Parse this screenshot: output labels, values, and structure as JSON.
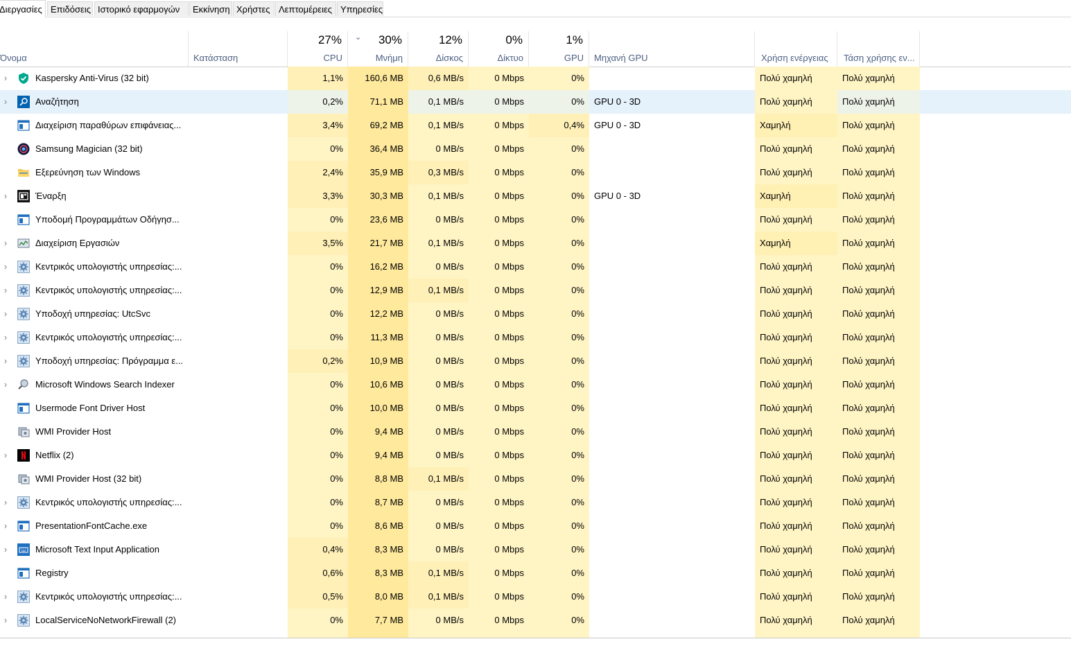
{
  "tabs": [
    "Διεργασίες",
    "Επιδόσεις",
    "Ιστορικό εφαρμογών",
    "Εκκίνηση",
    "Χρήστες",
    "Λεπτομέρειες",
    "Υπηρεσίες"
  ],
  "headers": {
    "name": "Όνομα",
    "status": "Κατάσταση",
    "cpu": {
      "pct": "27%",
      "label": "CPU"
    },
    "memory": {
      "pct": "30%",
      "label": "Μνήμη"
    },
    "disk": {
      "pct": "12%",
      "label": "Δίσκος"
    },
    "network": {
      "pct": "0%",
      "label": "Δίκτυο"
    },
    "gpu": {
      "pct": "1%",
      "label": "GPU"
    },
    "gpu_engine": "Μηχανή GPU",
    "power": "Χρήση ενέργειας",
    "power_trend": "Τάση χρήσης εν..."
  },
  "colors": {
    "heat_light": "#fff4c4",
    "heat_mid": "#ffe99c",
    "heat_power": "#fff0b4",
    "selected": "#e5f1fb"
  },
  "processes": [
    {
      "name": "Kaspersky Anti-Virus (32 bit)",
      "icon": "kaspersky-icon",
      "expandable": true,
      "cpu": "1,1%",
      "mem": "160,6 MB",
      "disk": "0,6 MB/s",
      "net": "0 Mbps",
      "gpu": "0%",
      "engine": "",
      "power": "Πολύ χαμηλή",
      "trend": "Πολύ χαμηλή",
      "heat": {
        "cpu": 1,
        "mem": 2,
        "disk": 1,
        "net": 0,
        "gpu": 0,
        "power": 0
      }
    },
    {
      "name": "Αναζήτηση",
      "icon": "search-icon",
      "expandable": true,
      "selected": true,
      "cpu": "0,2%",
      "mem": "71,1 MB",
      "disk": "0,1 MB/s",
      "net": "0 Mbps",
      "gpu": "0%",
      "engine": "GPU 0 - 3D",
      "power": "Πολύ χαμηλή",
      "trend": "Πολύ χαμηλή",
      "heat": {
        "cpu": 0,
        "mem": 1,
        "disk": 0,
        "net": 0,
        "gpu": 0,
        "power": 0
      }
    },
    {
      "name": "Διαχείριση παραθύρων επιφάνειας...",
      "icon": "window-icon",
      "expandable": false,
      "cpu": "3,4%",
      "mem": "69,2 MB",
      "disk": "0,1 MB/s",
      "net": "0 Mbps",
      "gpu": "0,4%",
      "engine": "GPU 0 - 3D",
      "power": "Χαμηλή",
      "trend": "Πολύ χαμηλή",
      "heat": {
        "cpu": 1,
        "mem": 1,
        "disk": 0,
        "net": 0,
        "gpu": 1,
        "power": 1
      }
    },
    {
      "name": "Samsung Magician (32 bit)",
      "icon": "samsung-magician-icon",
      "expandable": false,
      "cpu": "0%",
      "mem": "36,4 MB",
      "disk": "0 MB/s",
      "net": "0 Mbps",
      "gpu": "0%",
      "engine": "",
      "power": "Πολύ χαμηλή",
      "trend": "Πολύ χαμηλή",
      "heat": {
        "cpu": 0,
        "mem": 1,
        "disk": 0,
        "net": 0,
        "gpu": 0,
        "power": 0
      }
    },
    {
      "name": "Εξερεύνηση των Windows",
      "icon": "folder-icon",
      "expandable": false,
      "cpu": "2,4%",
      "mem": "35,9 MB",
      "disk": "0,3 MB/s",
      "net": "0 Mbps",
      "gpu": "0%",
      "engine": "",
      "power": "Πολύ χαμηλή",
      "trend": "Πολύ χαμηλή",
      "heat": {
        "cpu": 1,
        "mem": 1,
        "disk": 1,
        "net": 0,
        "gpu": 0,
        "power": 0
      }
    },
    {
      "name": "Έναρξη",
      "icon": "start-icon",
      "expandable": true,
      "cpu": "3,3%",
      "mem": "30,3 MB",
      "disk": "0,1 MB/s",
      "net": "0 Mbps",
      "gpu": "0%",
      "engine": "GPU 0 - 3D",
      "power": "Χαμηλή",
      "trend": "Πολύ χαμηλή",
      "heat": {
        "cpu": 1,
        "mem": 1,
        "disk": 0,
        "net": 0,
        "gpu": 0,
        "power": 1
      }
    },
    {
      "name": "Υποδομή Προγραμμάτων Οδήγησ...",
      "icon": "window-icon",
      "expandable": false,
      "cpu": "0%",
      "mem": "23,6 MB",
      "disk": "0 MB/s",
      "net": "0 Mbps",
      "gpu": "0%",
      "engine": "",
      "power": "Πολύ χαμηλή",
      "trend": "Πολύ χαμηλή",
      "heat": {
        "cpu": 0,
        "mem": 1,
        "disk": 0,
        "net": 0,
        "gpu": 0,
        "power": 0
      }
    },
    {
      "name": "Διαχείριση Εργασιών",
      "icon": "task-manager-icon",
      "expandable": true,
      "cpu": "3,5%",
      "mem": "21,7 MB",
      "disk": "0,1 MB/s",
      "net": "0 Mbps",
      "gpu": "0%",
      "engine": "",
      "power": "Χαμηλή",
      "trend": "Πολύ χαμηλή",
      "heat": {
        "cpu": 1,
        "mem": 1,
        "disk": 0,
        "net": 0,
        "gpu": 0,
        "power": 1
      }
    },
    {
      "name": "Κεντρικός υπολογιστής υπηρεσίας:...",
      "icon": "gear-icon",
      "expandable": true,
      "cpu": "0%",
      "mem": "16,2 MB",
      "disk": "0 MB/s",
      "net": "0 Mbps",
      "gpu": "0%",
      "engine": "",
      "power": "Πολύ χαμηλή",
      "trend": "Πολύ χαμηλή",
      "heat": {
        "cpu": 0,
        "mem": 1,
        "disk": 0,
        "net": 0,
        "gpu": 0,
        "power": 0
      }
    },
    {
      "name": "Κεντρικός υπολογιστής υπηρεσίας:...",
      "icon": "gear-icon",
      "expandable": true,
      "cpu": "0%",
      "mem": "12,9 MB",
      "disk": "0,1 MB/s",
      "net": "0 Mbps",
      "gpu": "0%",
      "engine": "",
      "power": "Πολύ χαμηλή",
      "trend": "Πολύ χαμηλή",
      "heat": {
        "cpu": 0,
        "mem": 1,
        "disk": 1,
        "net": 0,
        "gpu": 0,
        "power": 0
      }
    },
    {
      "name": "Υποδοχή υπηρεσίας: UtcSvc",
      "icon": "gear-icon",
      "expandable": true,
      "cpu": "0%",
      "mem": "12,2 MB",
      "disk": "0 MB/s",
      "net": "0 Mbps",
      "gpu": "0%",
      "engine": "",
      "power": "Πολύ χαμηλή",
      "trend": "Πολύ χαμηλή",
      "heat": {
        "cpu": 0,
        "mem": 1,
        "disk": 0,
        "net": 0,
        "gpu": 0,
        "power": 0
      }
    },
    {
      "name": "Κεντρικός υπολογιστής υπηρεσίας:...",
      "icon": "gear-icon",
      "expandable": true,
      "cpu": "0%",
      "mem": "11,3 MB",
      "disk": "0 MB/s",
      "net": "0 Mbps",
      "gpu": "0%",
      "engine": "",
      "power": "Πολύ χαμηλή",
      "trend": "Πολύ χαμηλή",
      "heat": {
        "cpu": 0,
        "mem": 1,
        "disk": 0,
        "net": 0,
        "gpu": 0,
        "power": 0
      }
    },
    {
      "name": "Υποδοχή υπηρεσίας: Πρόγραμμα ε...",
      "icon": "gear-icon",
      "expandable": true,
      "cpu": "0,2%",
      "mem": "10,9 MB",
      "disk": "0 MB/s",
      "net": "0 Mbps",
      "gpu": "0%",
      "engine": "",
      "power": "Πολύ χαμηλή",
      "trend": "Πολύ χαμηλή",
      "heat": {
        "cpu": 1,
        "mem": 1,
        "disk": 0,
        "net": 0,
        "gpu": 0,
        "power": 0
      }
    },
    {
      "name": "Microsoft Windows Search Indexer",
      "icon": "search-indexer-icon",
      "expandable": true,
      "cpu": "0%",
      "mem": "10,6 MB",
      "disk": "0 MB/s",
      "net": "0 Mbps",
      "gpu": "0%",
      "engine": "",
      "power": "Πολύ χαμηλή",
      "trend": "Πολύ χαμηλή",
      "heat": {
        "cpu": 0,
        "mem": 1,
        "disk": 0,
        "net": 0,
        "gpu": 0,
        "power": 0
      }
    },
    {
      "name": "Usermode Font Driver Host",
      "icon": "window-icon",
      "expandable": false,
      "cpu": "0%",
      "mem": "10,0 MB",
      "disk": "0 MB/s",
      "net": "0 Mbps",
      "gpu": "0%",
      "engine": "",
      "power": "Πολύ χαμηλή",
      "trend": "Πολύ χαμηλή",
      "heat": {
        "cpu": 0,
        "mem": 1,
        "disk": 0,
        "net": 0,
        "gpu": 0,
        "power": 0
      }
    },
    {
      "name": "WMI Provider Host",
      "icon": "wmi-icon",
      "expandable": false,
      "cpu": "0%",
      "mem": "9,4 MB",
      "disk": "0 MB/s",
      "net": "0 Mbps",
      "gpu": "0%",
      "engine": "",
      "power": "Πολύ χαμηλή",
      "trend": "Πολύ χαμηλή",
      "heat": {
        "cpu": 0,
        "mem": 1,
        "disk": 0,
        "net": 0,
        "gpu": 0,
        "power": 0
      }
    },
    {
      "name": "Netflix (2)",
      "icon": "netflix-icon",
      "expandable": true,
      "cpu": "0%",
      "mem": "9,4 MB",
      "disk": "0 MB/s",
      "net": "0 Mbps",
      "gpu": "0%",
      "engine": "",
      "power": "Πολύ χαμηλή",
      "trend": "Πολύ χαμηλή",
      "heat": {
        "cpu": 0,
        "mem": 1,
        "disk": 0,
        "net": 0,
        "gpu": 0,
        "power": 0
      }
    },
    {
      "name": "WMI Provider Host (32 bit)",
      "icon": "wmi-icon",
      "expandable": false,
      "cpu": "0%",
      "mem": "8,8 MB",
      "disk": "0,1 MB/s",
      "net": "0 Mbps",
      "gpu": "0%",
      "engine": "",
      "power": "Πολύ χαμηλή",
      "trend": "Πολύ χαμηλή",
      "heat": {
        "cpu": 0,
        "mem": 1,
        "disk": 1,
        "net": 0,
        "gpu": 0,
        "power": 0
      }
    },
    {
      "name": "Κεντρικός υπολογιστής υπηρεσίας:...",
      "icon": "gear-icon",
      "expandable": true,
      "cpu": "0%",
      "mem": "8,7 MB",
      "disk": "0 MB/s",
      "net": "0 Mbps",
      "gpu": "0%",
      "engine": "",
      "power": "Πολύ χαμηλή",
      "trend": "Πολύ χαμηλή",
      "heat": {
        "cpu": 0,
        "mem": 1,
        "disk": 0,
        "net": 0,
        "gpu": 0,
        "power": 0
      }
    },
    {
      "name": "PresentationFontCache.exe",
      "icon": "window-icon",
      "expandable": true,
      "cpu": "0%",
      "mem": "8,6 MB",
      "disk": "0 MB/s",
      "net": "0 Mbps",
      "gpu": "0%",
      "engine": "",
      "power": "Πολύ χαμηλή",
      "trend": "Πολύ χαμηλή",
      "heat": {
        "cpu": 0,
        "mem": 1,
        "disk": 0,
        "net": 0,
        "gpu": 0,
        "power": 0
      }
    },
    {
      "name": "Microsoft Text Input Application",
      "icon": "text-input-icon",
      "expandable": true,
      "cpu": "0,4%",
      "mem": "8,3 MB",
      "disk": "0 MB/s",
      "net": "0 Mbps",
      "gpu": "0%",
      "engine": "",
      "power": "Πολύ χαμηλή",
      "trend": "Πολύ χαμηλή",
      "heat": {
        "cpu": 1,
        "mem": 1,
        "disk": 0,
        "net": 0,
        "gpu": 0,
        "power": 0
      }
    },
    {
      "name": "Registry",
      "icon": "window-icon",
      "expandable": false,
      "cpu": "0,6%",
      "mem": "8,3 MB",
      "disk": "0,1 MB/s",
      "net": "0 Mbps",
      "gpu": "0%",
      "engine": "",
      "power": "Πολύ χαμηλή",
      "trend": "Πολύ χαμηλή",
      "heat": {
        "cpu": 1,
        "mem": 1,
        "disk": 1,
        "net": 0,
        "gpu": 0,
        "power": 0
      }
    },
    {
      "name": "Κεντρικός υπολογιστής υπηρεσίας:...",
      "icon": "gear-icon",
      "expandable": true,
      "cpu": "0,5%",
      "mem": "8,0 MB",
      "disk": "0,1 MB/s",
      "net": "0 Mbps",
      "gpu": "0%",
      "engine": "",
      "power": "Πολύ χαμηλή",
      "trend": "Πολύ χαμηλή",
      "heat": {
        "cpu": 1,
        "mem": 1,
        "disk": 1,
        "net": 0,
        "gpu": 0,
        "power": 0
      }
    },
    {
      "name": "LocalServiceNoNetworkFirewall (2)",
      "icon": "gear-icon",
      "expandable": true,
      "cpu": "0%",
      "mem": "7,7 MB",
      "disk": "0 MB/s",
      "net": "0 Mbps",
      "gpu": "0%",
      "engine": "",
      "power": "Πολύ χαμηλή",
      "trend": "Πολύ χαμηλή",
      "heat": {
        "cpu": 0,
        "mem": 1,
        "disk": 0,
        "net": 0,
        "gpu": 0,
        "power": 0
      }
    }
  ]
}
